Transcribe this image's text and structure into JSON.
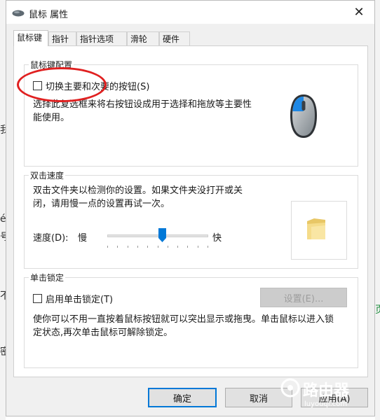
{
  "background": {
    "fragments": [
      "我",
      "é",
      "号",
      "不",
      "密",
      "页"
    ]
  },
  "window": {
    "title": "鼠标 属性",
    "close_glyph": "✕"
  },
  "tabs": [
    {
      "label": "鼠标键",
      "active": true
    },
    {
      "label": "指针",
      "active": false
    },
    {
      "label": "指针选项",
      "active": false
    },
    {
      "label": "滑轮",
      "active": false
    },
    {
      "label": "硬件",
      "active": false
    }
  ],
  "button_config": {
    "legend": "鼠标键配置",
    "checkbox_label": "切换主要和次要的按钮(S)",
    "checked": false,
    "description_line1": "选择此复选框来将右按钮设成用于选择和拖放等主要性",
    "description_line2": "能使用。"
  },
  "double_click": {
    "legend": "双击速度",
    "description_line1": "双击文件夹以检测你的设置。如果文件夹没打开或关",
    "description_line2": "闭，请用慢一点的设置再试一次。",
    "speed_label": "速度(D):",
    "slow_label": "慢",
    "fast_label": "快",
    "speed_fraction": 0.55
  },
  "click_lock": {
    "legend": "单击锁定",
    "checkbox_label": "启用单击锁定(T)",
    "checked": false,
    "settings_button": "设置(E)...",
    "description_line1": "使你可以不用一直按着鼠标按钮就可以突出显示或拖曳。单击鼠标以进入锁",
    "description_line2": "定状态,再次单击鼠标可解除锁定。"
  },
  "footer": {
    "ok": "确定",
    "cancel": "取消",
    "apply": "应用(A)"
  },
  "watermark": {
    "text": "路由器",
    "sub": "luyouqi.com"
  },
  "colors": {
    "accent": "#0078d7",
    "highlight_ring": "#e02020",
    "mouse_button": "#1e88e5"
  }
}
